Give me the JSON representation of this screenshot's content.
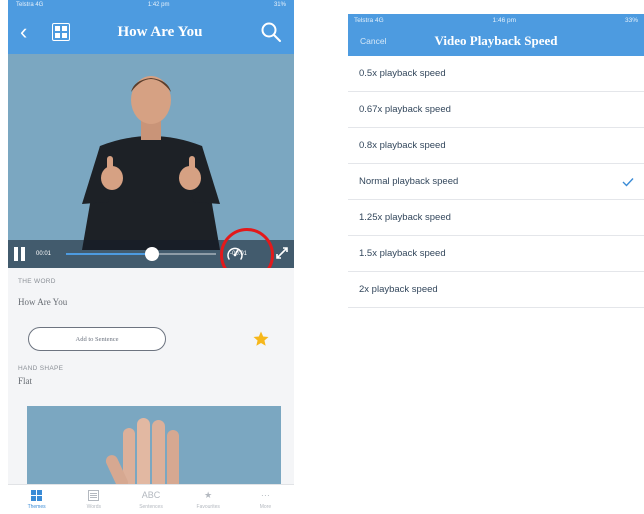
{
  "left": {
    "status": {
      "carrier": "Telstra 4G",
      "time": "1:42 pm",
      "battery": "31%"
    },
    "nav": {
      "title": "How Are You"
    },
    "video": {
      "current_time": "00:01",
      "remaining_time": "-00:01",
      "progress": 0.57
    },
    "word": {
      "label": "THE WORD",
      "value": "How Are You"
    },
    "add_button": "Add to Sentence",
    "favorite": true,
    "hand_shape": {
      "label": "HAND SHAPE",
      "value": "Flat"
    },
    "tabs": [
      {
        "label": "Themes",
        "icon": "grid-icon",
        "active": true
      },
      {
        "label": "Words",
        "icon": "list-icon",
        "active": false
      },
      {
        "label": "Sentences",
        "icon": "abc-icon",
        "active": false
      },
      {
        "label": "Favourites",
        "icon": "star-icon",
        "active": false
      },
      {
        "label": "More",
        "icon": "more-icon",
        "active": false
      }
    ]
  },
  "right": {
    "status": {
      "carrier": "Telstra 4G",
      "time": "1:46 pm",
      "battery": "33%"
    },
    "nav": {
      "cancel": "Cancel",
      "title": "Video Playback Speed"
    },
    "options": [
      {
        "label": "0.5x playback speed",
        "selected": false
      },
      {
        "label": "0.67x playback speed",
        "selected": false
      },
      {
        "label": "0.8x playback speed",
        "selected": false
      },
      {
        "label": "Normal playback speed",
        "selected": true
      },
      {
        "label": "1.25x playback speed",
        "selected": false
      },
      {
        "label": "1.5x playback speed",
        "selected": false
      },
      {
        "label": "2x playback speed",
        "selected": false
      }
    ]
  },
  "colors": {
    "header": "#4d9be0",
    "accent": "#3a8bd6",
    "highlight": "#e3191b",
    "star": "#f6b71b"
  }
}
